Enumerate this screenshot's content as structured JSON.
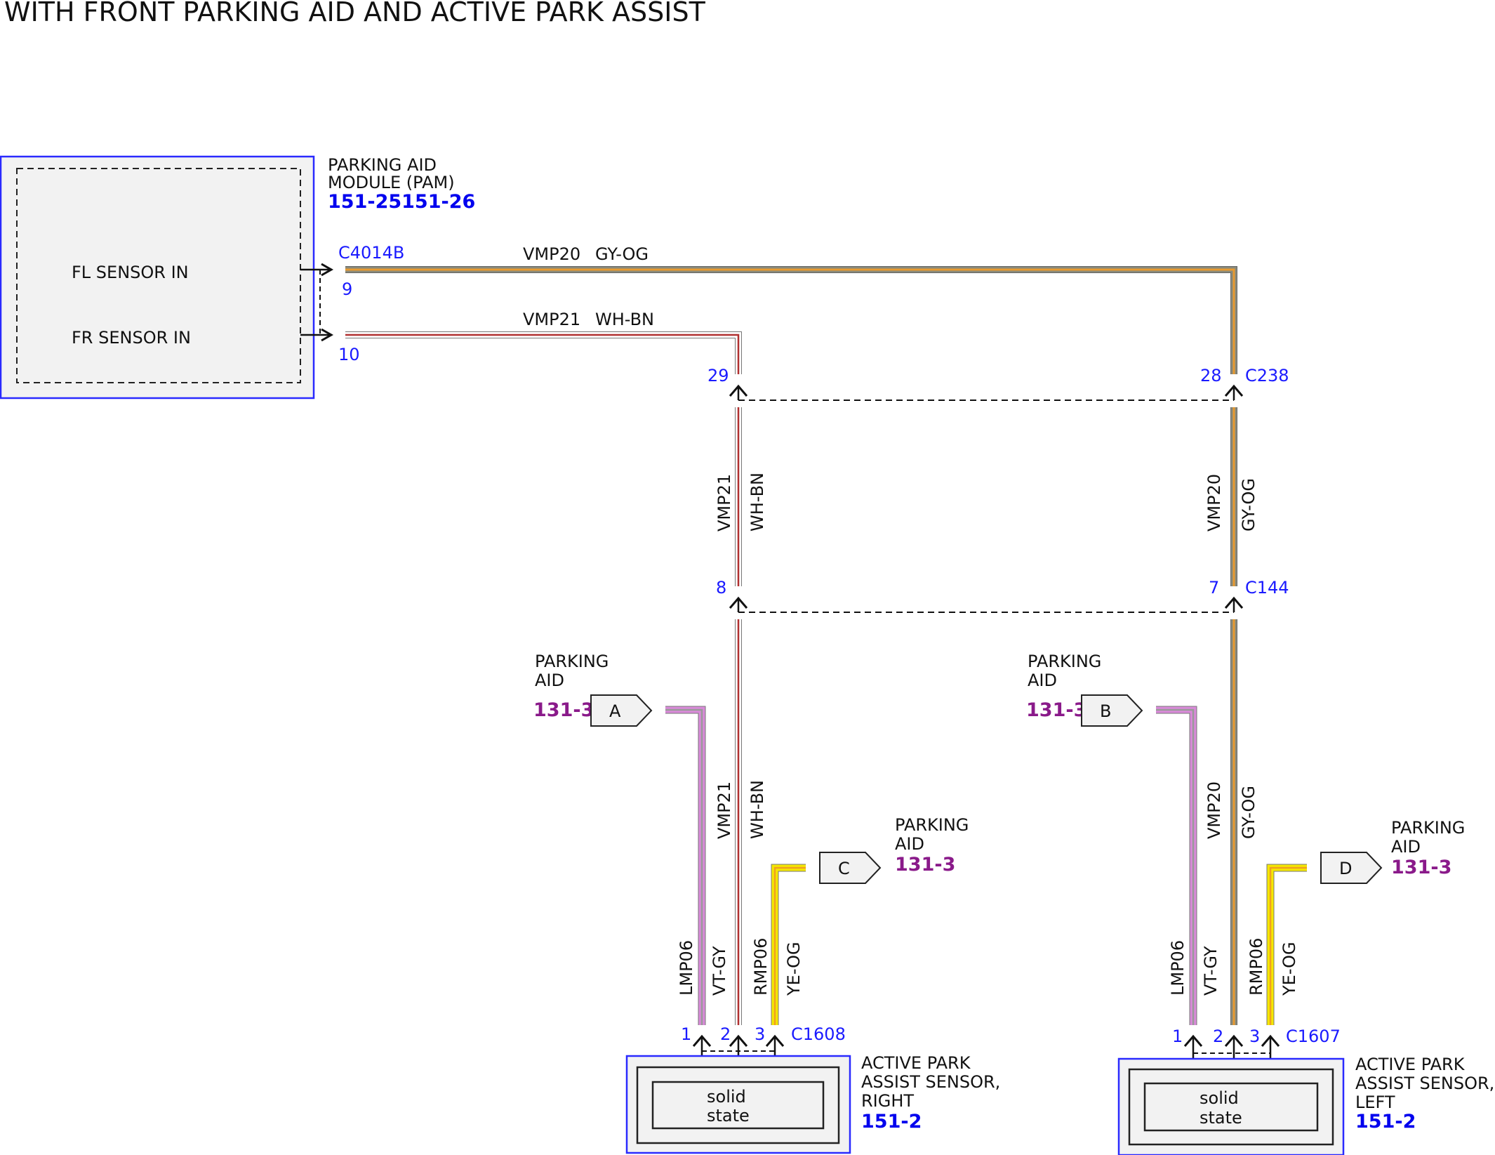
{
  "title": "WITH FRONT PARKING AID AND ACTIVE PARK ASSIST",
  "colors": {
    "gy_og_main": "#8a8a7a",
    "gy_og_stripe": "#e89a30",
    "wh_bn_main": "#ffffff",
    "wh_bn_stripe": "#b03030",
    "vt_gy_main": "#d98ad9",
    "vt_gy_stripe": "#9a9a9a",
    "ye_og_main": "#f5e800",
    "ye_og_stripe": "#f0a020",
    "connector_text": "#1a1aff",
    "reference_blue": "#0000ee",
    "reference_purple": "#8a1a8a"
  },
  "module": {
    "name_line1": "PARKING AID",
    "name_line2": "MODULE (PAM)",
    "reference": "151-25151-26",
    "pin_labels": [
      "FL SENSOR IN",
      "FR SENSOR IN"
    ],
    "connector": "C4014B",
    "pins": [
      "9",
      "10"
    ]
  },
  "wires": {
    "vmp20": {
      "circuit": "VMP20",
      "color": "GY-OG"
    },
    "vmp21": {
      "circuit": "VMP21",
      "color": "WH-BN"
    },
    "lmp06": {
      "circuit": "LMP06",
      "color": "VT-GY"
    },
    "rmp06": {
      "circuit": "RMP06",
      "color": "YE-OG"
    }
  },
  "inline_connectors": {
    "c238": {
      "name": "C238",
      "pin_left": "29",
      "pin_right": "28"
    },
    "c144": {
      "name": "C144",
      "pin_left": "8",
      "pin_right": "7"
    }
  },
  "offpage": {
    "label_line1": "PARKING",
    "label_line2": "AID",
    "reference": "131-3",
    "a": "A",
    "b": "B",
    "c": "C",
    "d": "D"
  },
  "sensor_right": {
    "connector": "C1608",
    "pins": [
      "1",
      "2",
      "3"
    ],
    "name_line1": "ACTIVE PARK",
    "name_line2": "ASSIST SENSOR,",
    "name_line3": "RIGHT",
    "reference": "151-2",
    "internal_line1": "solid",
    "internal_line2": "state"
  },
  "sensor_left": {
    "connector": "C1607",
    "pins": [
      "1",
      "2",
      "3"
    ],
    "name_line1": "ACTIVE PARK",
    "name_line2": "ASSIST SENSOR,",
    "name_line3": "LEFT",
    "reference": "151-2",
    "internal_line1": "solid",
    "internal_line2": "state"
  }
}
